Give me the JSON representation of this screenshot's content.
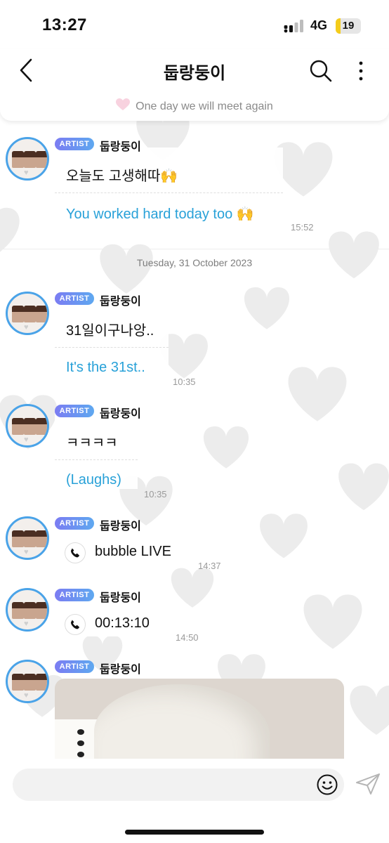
{
  "status_bar": {
    "time": "13:27",
    "network": "4G",
    "battery": "19",
    "battery_level": 0.19
  },
  "header": {
    "title": "둡랑둥이",
    "notice": "One day we will meet again"
  },
  "chat": {
    "date_separator": "Tuesday, 31 October 2023",
    "messages": [
      {
        "badge": "ARTIST",
        "sender": "둡랑둥이",
        "text": "오늘도 고생해따🙌",
        "translation": "You worked hard today too 🙌",
        "time": "15:52"
      },
      {
        "badge": "ARTIST",
        "sender": "둡랑둥이",
        "text": "31일이구나앙..",
        "translation": "It's the 31st..",
        "time": "10:35"
      },
      {
        "badge": "ARTIST",
        "sender": "둡랑둥이",
        "text": "ㅋㅋㅋㅋ",
        "translation": "(Laughs)",
        "time": "10:35"
      },
      {
        "badge": "ARTIST",
        "sender": "둡랑둥이",
        "text": "bubble LIVE",
        "time": "14:37",
        "icon": "phone-icon"
      },
      {
        "badge": "ARTIST",
        "sender": "둡랑둥이",
        "text": "00:13:10",
        "time": "14:50",
        "icon": "phone-icon"
      },
      {
        "badge": "ARTIST",
        "sender": "둡랑둥이"
      }
    ]
  },
  "input": {
    "placeholder": ""
  },
  "colors": {
    "accent": "#28a1d8",
    "badge_start": "#7b7cf2",
    "badge_end": "#5ea8f0",
    "avatar_ring": "#4aa3e8",
    "heart": "#ececec"
  }
}
